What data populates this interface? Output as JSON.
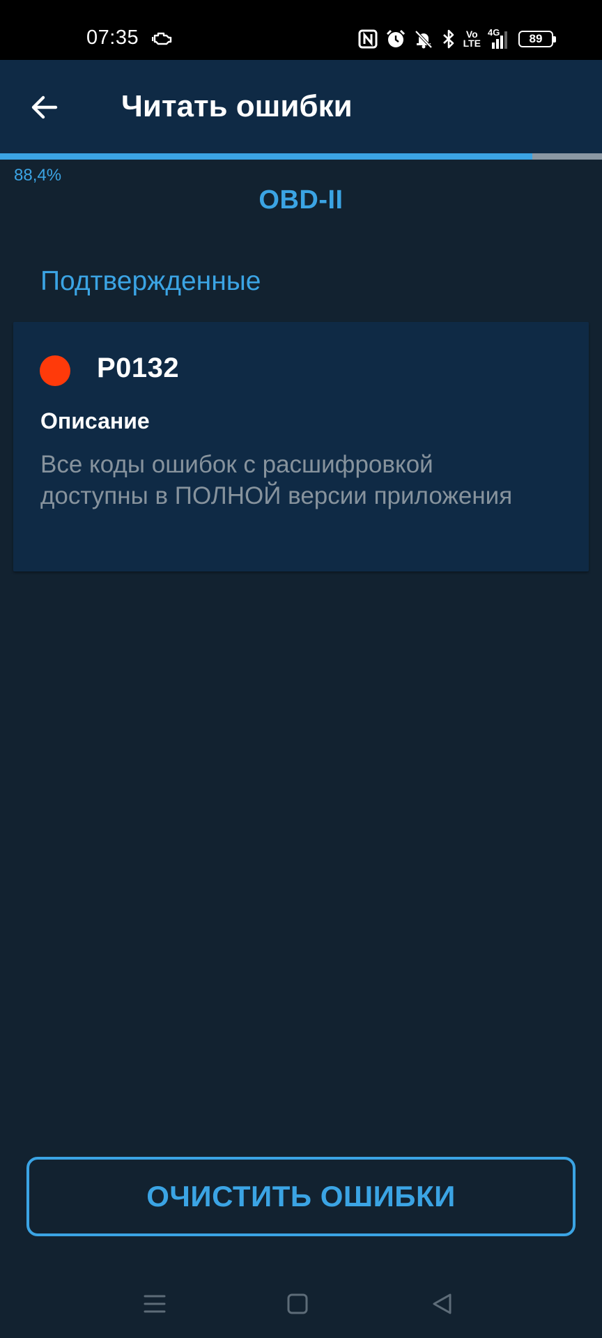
{
  "status_bar": {
    "time": "07:35",
    "network_label": "4G",
    "volte_line1": "Vo",
    "volte_line2": "LTE",
    "battery_level": "89"
  },
  "app_bar": {
    "title": "Читать ошибки"
  },
  "progress": {
    "percent": 88.4,
    "label": "88,4%"
  },
  "protocol": {
    "title": "OBD-II"
  },
  "section": {
    "heading": "Подтвержденные"
  },
  "error_card": {
    "code": "P0132",
    "description_label": "Описание",
    "description_text": "Все коды ошибок с расшифровкой доступны в ПОЛНОЙ версии приложения"
  },
  "actions": {
    "clear_label": "ОЧИСТИТЬ ОШИБКИ"
  },
  "icons": {
    "back": "arrow-left-icon",
    "engine": "check-engine-icon",
    "nfc": "nfc-icon",
    "alarm": "alarm-icon",
    "mute": "bell-off-icon",
    "bluetooth": "bluetooth-icon",
    "signal": "signal-icon",
    "nav_menu": "menu-icon",
    "nav_home": "home-icon",
    "nav_back": "back-triangle-icon"
  },
  "colors": {
    "background": "#122230",
    "app_bar": "#0f2a45",
    "accent": "#3ba4e4",
    "error_dot": "#ff3a0a",
    "muted_text": "#87939d"
  }
}
